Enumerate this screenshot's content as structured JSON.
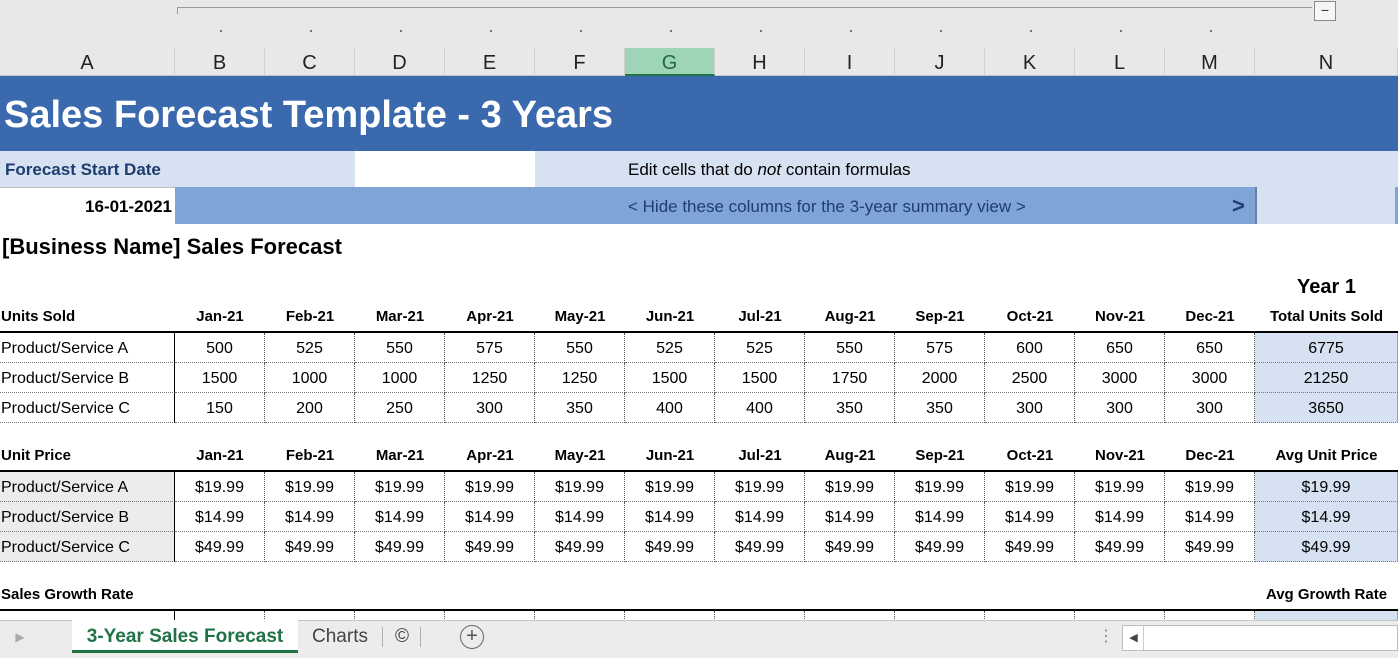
{
  "columns": [
    "A",
    "B",
    "C",
    "D",
    "E",
    "F",
    "G",
    "H",
    "I",
    "J",
    "K",
    "L",
    "M",
    "N"
  ],
  "selected_column": "G",
  "banner_title": "Sales Forecast Template - 3 Years",
  "forecast_start_label": "Forecast Start Date",
  "edit_note": {
    "pre": "Edit cells that do ",
    "em": "not",
    "post": " contain formulas"
  },
  "start_date": "16-01-2021",
  "hide_note": "< Hide these columns for the 3-year summary view >",
  "hide_arrow": ">",
  "business_title": "[Business Name] Sales Forecast",
  "year_label": "Year 1",
  "months": [
    "Jan-21",
    "Feb-21",
    "Mar-21",
    "Apr-21",
    "May-21",
    "Jun-21",
    "Jul-21",
    "Aug-21",
    "Sep-21",
    "Oct-21",
    "Nov-21",
    "Dec-21"
  ],
  "units": {
    "label": "Units Sold",
    "total_label": "Total Units Sold",
    "rows": [
      {
        "name": "Product/Service A",
        "values": [
          "500",
          "525",
          "550",
          "575",
          "550",
          "525",
          "525",
          "550",
          "575",
          "600",
          "650",
          "650"
        ],
        "total": "6775"
      },
      {
        "name": "Product/Service B",
        "values": [
          "1500",
          "1000",
          "1000",
          "1250",
          "1250",
          "1500",
          "1500",
          "1750",
          "2000",
          "2500",
          "3000",
          "3000"
        ],
        "total": "21250"
      },
      {
        "name": "Product/Service C",
        "values": [
          "150",
          "200",
          "250",
          "300",
          "350",
          "400",
          "400",
          "350",
          "350",
          "300",
          "300",
          "300"
        ],
        "total": "3650"
      }
    ]
  },
  "price": {
    "label": "Unit Price",
    "total_label": "Avg Unit Price",
    "rows": [
      {
        "name": "Product/Service A",
        "values": [
          "$19.99",
          "$19.99",
          "$19.99",
          "$19.99",
          "$19.99",
          "$19.99",
          "$19.99",
          "$19.99",
          "$19.99",
          "$19.99",
          "$19.99",
          "$19.99"
        ],
        "total": "$19.99"
      },
      {
        "name": "Product/Service B",
        "values": [
          "$14.99",
          "$14.99",
          "$14.99",
          "$14.99",
          "$14.99",
          "$14.99",
          "$14.99",
          "$14.99",
          "$14.99",
          "$14.99",
          "$14.99",
          "$14.99"
        ],
        "total": "$14.99"
      },
      {
        "name": "Product/Service C",
        "values": [
          "$49.99",
          "$49.99",
          "$49.99",
          "$49.99",
          "$49.99",
          "$49.99",
          "$49.99",
          "$49.99",
          "$49.99",
          "$49.99",
          "$49.99",
          "$49.99"
        ],
        "total": "$49.99"
      }
    ]
  },
  "growth": {
    "label": "Sales Growth Rate",
    "total_label": "Avg Growth Rate"
  },
  "tabs": {
    "active": "3-Year Sales Forecast",
    "charts": "Charts",
    "copyright": "©",
    "add": "+"
  }
}
